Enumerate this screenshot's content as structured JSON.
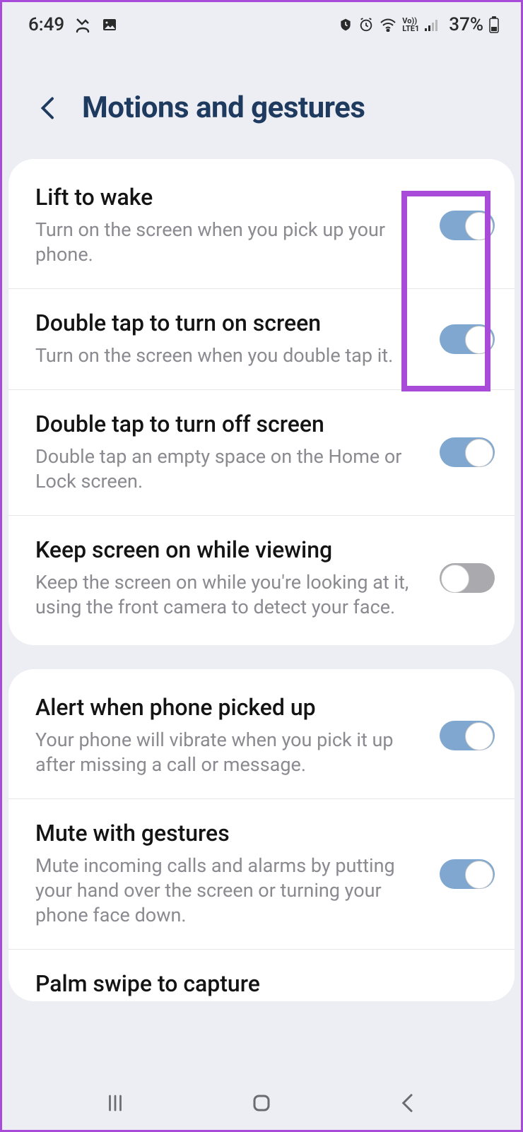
{
  "status": {
    "time": "6:49",
    "battery_pct": "37%",
    "network_label": "LTE1",
    "volte_label": "Vo"
  },
  "header": {
    "title": "Motions and gestures"
  },
  "groups": [
    {
      "rows": [
        {
          "title": "Lift to wake",
          "sub": "Turn on the screen when you pick up your phone.",
          "on": true
        },
        {
          "title": "Double tap to turn on screen",
          "sub": "Turn on the screen when you double tap it.",
          "on": true
        },
        {
          "title": "Double tap to turn off screen",
          "sub": "Double tap an empty space on the Home or Lock screen.",
          "on": true
        },
        {
          "title": "Keep screen on while viewing",
          "sub": "Keep the screen on while you're looking at it, using the front camera to detect your face.",
          "on": false
        }
      ]
    },
    {
      "rows": [
        {
          "title": "Alert when phone picked up",
          "sub": "Your phone will vibrate when you pick it up after missing a call or message.",
          "on": true
        },
        {
          "title": "Mute with gestures",
          "sub": "Mute incoming calls and alarms by putting your hand over the screen or turning your phone face down.",
          "on": true
        },
        {
          "title": "Palm swipe to capture",
          "sub": "",
          "on": true,
          "cut": true
        }
      ]
    }
  ]
}
